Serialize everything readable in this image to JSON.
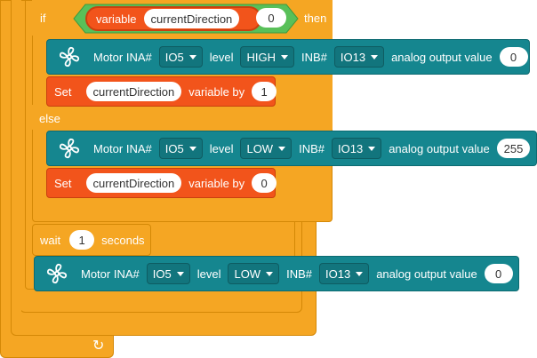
{
  "if_block": {
    "if_label": "if",
    "then_label": "then",
    "else_label": "else",
    "condition": {
      "variable_label": "variable",
      "variable_name": "currentDirection",
      "operator": "=",
      "value": "0"
    }
  },
  "motor_blocks": [
    {
      "label": "Motor INA#",
      "ina": "IO5",
      "level_label": "level",
      "level": "HIGH",
      "inb_label": "INB#",
      "inb": "IO13",
      "analog_label": "analog output value",
      "analog_value": "0"
    },
    {
      "label": "Motor INA#",
      "ina": "IO5",
      "level_label": "level",
      "level": "LOW",
      "inb_label": "INB#",
      "inb": "IO13",
      "analog_label": "analog output value",
      "analog_value": "255"
    },
    {
      "label": "Motor INA#",
      "ina": "IO5",
      "level_label": "level",
      "level": "LOW",
      "inb_label": "INB#",
      "inb": "IO13",
      "analog_label": "analog output value",
      "analog_value": "0"
    }
  ],
  "set_blocks": [
    {
      "set_label": "Set",
      "variable": "currentDirection",
      "by_label": "variable by",
      "value": "1"
    },
    {
      "set_label": "Set",
      "variable": "currentDirection",
      "by_label": "variable by",
      "value": "0"
    }
  ],
  "wait_block": {
    "wait_label": "wait",
    "value": "1",
    "unit_label": "seconds"
  },
  "loop_icon": {
    "glyph": "↻"
  },
  "colors": {
    "control": "#f5a623",
    "motor": "#15868f",
    "variable": "#f2541b",
    "operator": "#59c059"
  }
}
